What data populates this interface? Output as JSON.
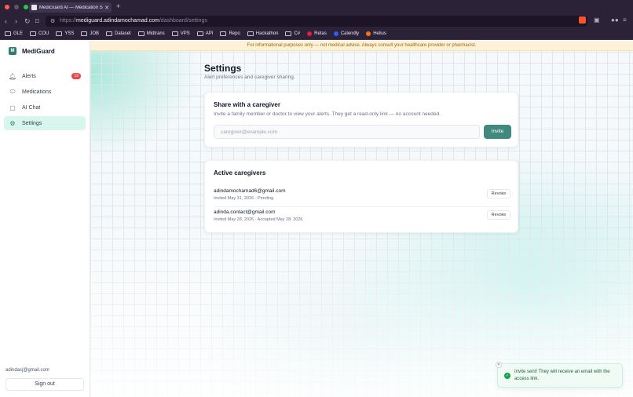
{
  "browser": {
    "tab_title": "MediGuard AI — Medication S…",
    "url_prefix": "https://",
    "url_host": "mediguard.adindamochamad.com",
    "url_path": "/dashboard/settings",
    "bookmarks": [
      {
        "label": "GLE",
        "icon": "folder-icon"
      },
      {
        "label": "COU",
        "icon": "folder-icon"
      },
      {
        "label": "YSS",
        "icon": "folder-icon"
      },
      {
        "label": "JOB",
        "icon": "folder-icon"
      },
      {
        "label": "Dataset",
        "icon": "folder-icon"
      },
      {
        "label": "Midtrans",
        "icon": "folder-icon"
      },
      {
        "label": "VPS",
        "icon": "folder-icon"
      },
      {
        "label": "API",
        "icon": "folder-icon"
      },
      {
        "label": "Repo",
        "icon": "folder-icon"
      },
      {
        "label": "Hackathon",
        "icon": "folder-icon"
      },
      {
        "label": "C#",
        "icon": "folder-icon"
      },
      {
        "label": "Retas",
        "icon": "retas-icon"
      },
      {
        "label": "Calendly",
        "icon": "calendly-icon"
      },
      {
        "label": "Helius",
        "icon": "helius-icon"
      }
    ]
  },
  "sidebar": {
    "brand": {
      "logo_letter": "M",
      "name": "MediGuard"
    },
    "items": [
      {
        "label": "Alerts",
        "icon": "bell-icon",
        "badge": "12"
      },
      {
        "label": "Medications",
        "icon": "pill-icon"
      },
      {
        "label": "AI Chat",
        "icon": "chat-icon"
      },
      {
        "label": "Settings",
        "icon": "gear-icon"
      }
    ],
    "user_email": "adindacj@gmail.com",
    "signout_label": "Sign out"
  },
  "banner": "For informational purposes only — not medical advice. Always consult your healthcare provider or pharmacist.",
  "page": {
    "title": "Settings",
    "subtitle": "Alert preferences and caregiver sharing."
  },
  "share": {
    "title": "Share with a caregiver",
    "description": "Invite a family member or doctor to view your alerts. They get a read-only link — no account needed.",
    "placeholder": "caregiver@example.com",
    "value": "",
    "invite_label": "Invite"
  },
  "caregivers": {
    "title": "Active caregivers",
    "rows": [
      {
        "email": "adindamochamad6@gmail.com",
        "meta": "Invited May 31, 2026 · Pending",
        "action": "Revoke"
      },
      {
        "email": "adinda.contact@gmail.com",
        "meta": "Invited May 28, 2026 · Accepted May 28, 2026",
        "action": "Revoke"
      }
    ]
  },
  "toast": {
    "message": "Invite sent! They will receive an email with the access link."
  },
  "colors": {
    "accent": "#3f8a7c",
    "active_nav_bg": "#d8f5ee",
    "banner_bg": "#fdf2d8",
    "badge": "#ef4444",
    "toast_bg": "#f0fbf5"
  }
}
